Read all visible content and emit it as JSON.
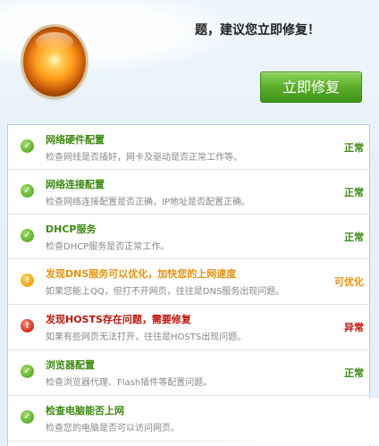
{
  "header": {
    "title": "题，建议您立即修复！",
    "fix_button_label": "立即修复"
  },
  "colors": {
    "ok": "#3d8a12",
    "warn": "#e8920a",
    "error": "#c0150a",
    "button": "#5aae2a"
  },
  "items": [
    {
      "icon": "check-circle-icon",
      "title": "网络硬件配置",
      "desc": "检查网线是否插好，网卡及驱动是否正常工作等。",
      "status": "正常",
      "level": "ok"
    },
    {
      "icon": "check-circle-icon",
      "title": "网络连接配置",
      "desc": "检查网络连接配置是否正确，IP地址是否配置正确。",
      "status": "正常",
      "level": "ok"
    },
    {
      "icon": "check-circle-icon",
      "title": "DHCP服务",
      "desc": "检查DHCP服务是否正常工作。",
      "status": "正常",
      "level": "ok"
    },
    {
      "icon": "warning-circle-icon",
      "title": "发现DNS服务可以优化，加快您的上网速度",
      "desc": "如果您能上QQ，但打不开网页，往往是DNS服务出现问题。",
      "status": "可优化",
      "level": "warn"
    },
    {
      "icon": "error-circle-icon",
      "title": "发现HOSTS存在问题，需要修复",
      "desc": "如果有些网页无法打开，往往是HOSTS出现问题。",
      "status": "异常",
      "level": "err"
    },
    {
      "icon": "check-circle-icon",
      "title": "浏览器配置",
      "desc": "检查浏览器代理、Flash插件等配置问题。",
      "status": "正常",
      "level": "ok"
    },
    {
      "icon": "check-circle-icon",
      "title": "检查电脑能否上网",
      "desc": "检查您的电脑是否可以访问网页。",
      "status": "",
      "level": "ok"
    }
  ]
}
